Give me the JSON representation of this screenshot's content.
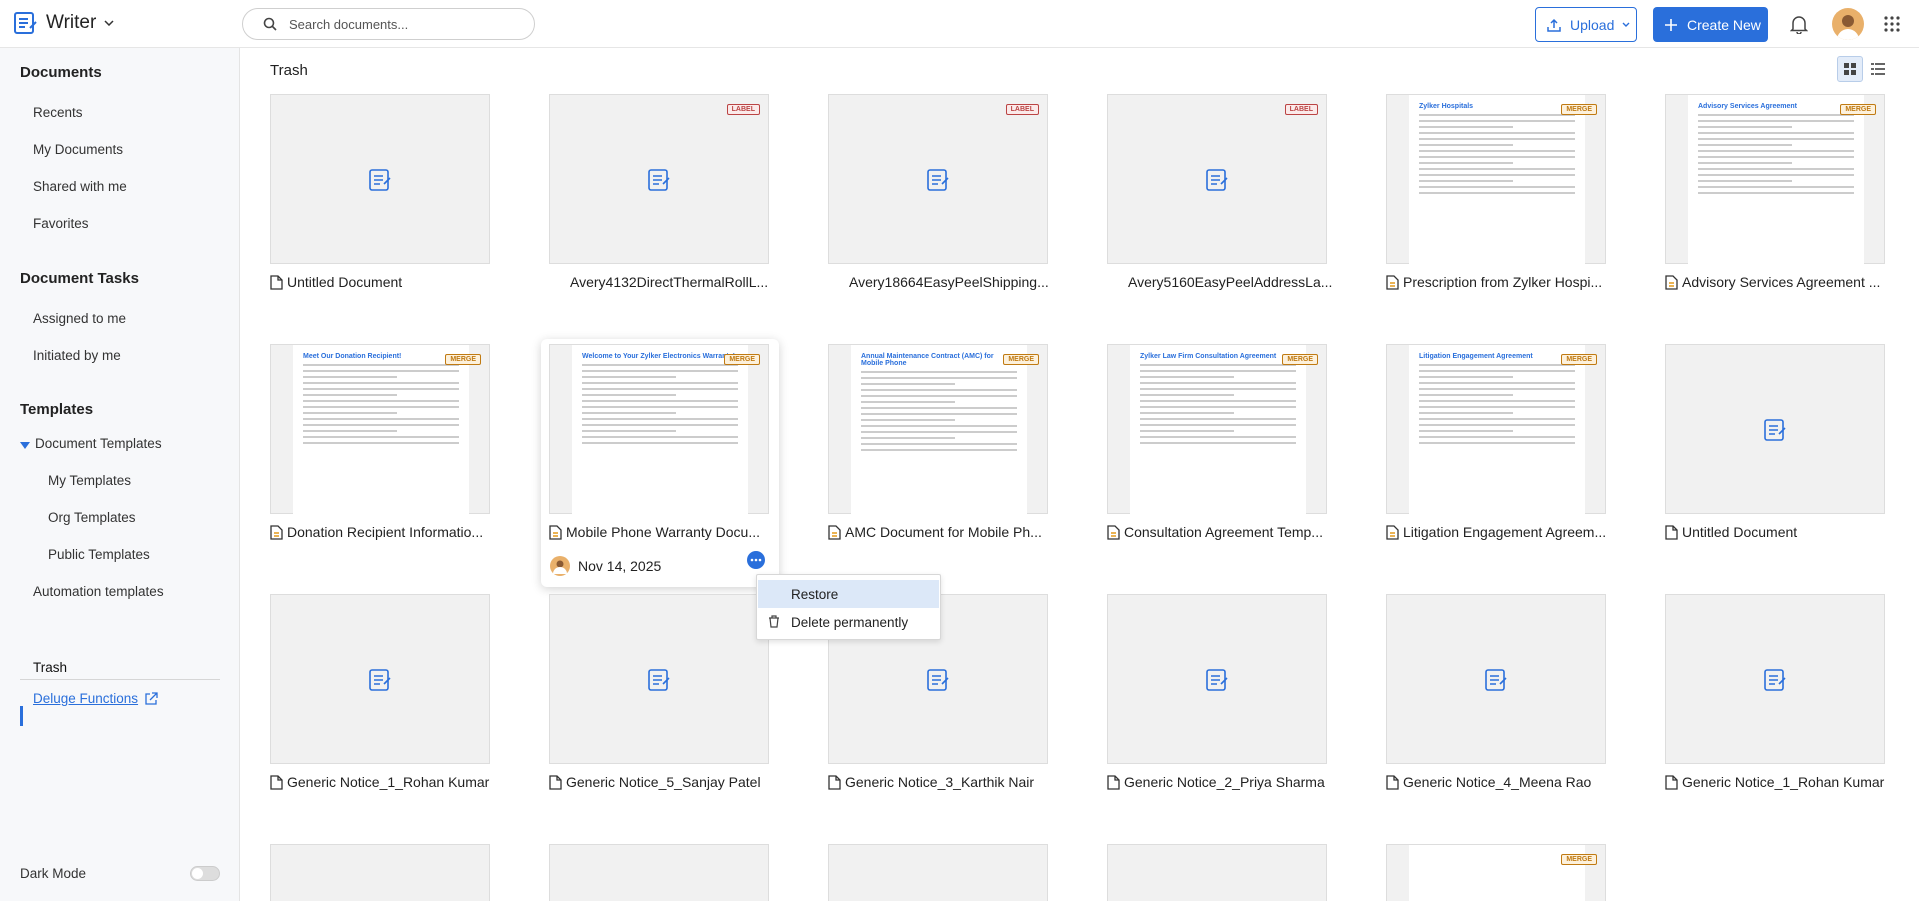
{
  "app": {
    "name": "Writer"
  },
  "search": {
    "placeholder": "Search documents..."
  },
  "header": {
    "upload_label": "Upload",
    "create_label": "Create New"
  },
  "sidebar": {
    "documents_heading": "Documents",
    "documents": [
      "Recents",
      "My Documents",
      "Shared with me",
      "Favorites"
    ],
    "tasks_heading": "Document Tasks",
    "tasks": [
      "Assigned to me",
      "Initiated by me"
    ],
    "templates_heading": "Templates",
    "doc_templates": "Document Templates",
    "template_items": [
      "My Templates",
      "Org Templates",
      "Public Templates"
    ],
    "automation": "Automation templates",
    "trash": "Trash",
    "deluge": "Deluge Functions",
    "dark_mode": "Dark Mode"
  },
  "main": {
    "title": "Trash"
  },
  "tags": {
    "label": "LABEL",
    "merge": "MERGE"
  },
  "cards": [
    {
      "name": "Untitled Document",
      "icon": true
    },
    {
      "name": "Avery4132DirectThermalRollL...",
      "icon": false,
      "tag": "LABEL"
    },
    {
      "name": "Avery18664EasyPeelShipping...",
      "icon": false,
      "tag": "LABEL"
    },
    {
      "name": "Avery5160EasyPeelAddressLa...",
      "icon": false,
      "tag": "LABEL"
    },
    {
      "name": "Prescription from Zylker Hospi...",
      "icon": true,
      "tag": "MERGE",
      "preview": "Zylker Hospitals"
    },
    {
      "name": "Advisory Services Agreement ...",
      "icon": true,
      "tag": "MERGE",
      "preview": "Advisory Services Agreement"
    },
    {
      "name": "Donation Recipient Informatio...",
      "icon": true,
      "tag": "MERGE",
      "preview": "Meet Our Donation Recipient!"
    },
    {
      "name": "Mobile Phone Warranty Docu...",
      "icon": true,
      "tag": "MERGE",
      "preview": "Welcome to Your Zylker Electronics Warranty!"
    },
    {
      "name": "AMC Document for Mobile Ph...",
      "icon": true,
      "tag": "MERGE",
      "preview": "Annual Maintenance Contract (AMC) for Mobile Phone"
    },
    {
      "name": "Consultation Agreement Temp...",
      "icon": true,
      "tag": "MERGE",
      "preview": "Zylker Law Firm Consultation Agreement"
    },
    {
      "name": "Litigation Engagement Agreem...",
      "icon": true,
      "tag": "MERGE",
      "preview": "Litigation Engagement Agreement"
    },
    {
      "name": "Untitled Document",
      "icon": true
    },
    {
      "name": "Generic Notice_1_Rohan Kumar",
      "icon": true
    },
    {
      "name": "Generic Notice_5_Sanjay Patel",
      "icon": true
    },
    {
      "name": "Generic Notice_3_Karthik Nair",
      "icon": true
    },
    {
      "name": "Generic Notice_2_Priya Sharma",
      "icon": true
    },
    {
      "name": "Generic Notice_4_Meena Rao",
      "icon": true
    },
    {
      "name": "Generic Notice_1_Rohan Kumar",
      "icon": true
    }
  ],
  "hover": {
    "date": "Nov 14, 2025"
  },
  "context_menu": {
    "restore": "Restore",
    "delete": "Delete permanently"
  }
}
